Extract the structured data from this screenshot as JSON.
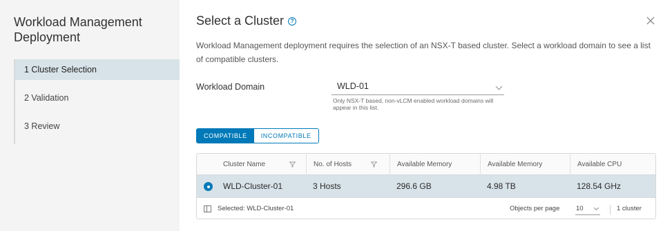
{
  "sidebar": {
    "title": "Workload Management Deployment",
    "steps": [
      {
        "label": "1  Cluster Selection",
        "active": true
      },
      {
        "label": "2  Validation",
        "active": false
      },
      {
        "label": "3  Review",
        "active": false
      }
    ]
  },
  "main": {
    "heading": "Select a Cluster",
    "help_icon": "?",
    "description": "Workload Management deployment requires the selection of an NSX-T based cluster. Select a workload domain to see a list of compatible clusters.",
    "workload_domain": {
      "label": "Workload Domain",
      "value": "WLD-01",
      "hint": "Only NSX-T based, non-vLCM enabled workload domains will appear in this list."
    },
    "toggle": {
      "compatible": "COMPATIBLE",
      "incompatible": "INCOMPATIBLE",
      "selected": "compatible"
    },
    "grid": {
      "columns": [
        "Cluster Name",
        "No. of Hosts",
        "Available Memory",
        "Available Memory",
        "Available CPU"
      ],
      "rows": [
        {
          "selected": true,
          "cluster_name": "WLD-Cluster-01",
          "hosts": "3 Hosts",
          "memory_1": "296.6 GB",
          "memory_2": "4.98 TB",
          "cpu": "128.54 GHz"
        }
      ],
      "footer": {
        "selected": "Selected: WLD-Cluster-01",
        "per_page_label": "Objects per page",
        "per_page_value": "10",
        "count": "1 cluster"
      }
    }
  },
  "colors": {
    "accent": "#0079b8",
    "selected_row": "#d8e3e9",
    "sidebar_bg": "#f4f4f4"
  },
  "icons": {
    "help": "help-circle-icon",
    "close": "close-icon",
    "filter": "filter-icon",
    "column_toggle": "column-toggle-icon",
    "caret": "chevron-down-icon"
  }
}
